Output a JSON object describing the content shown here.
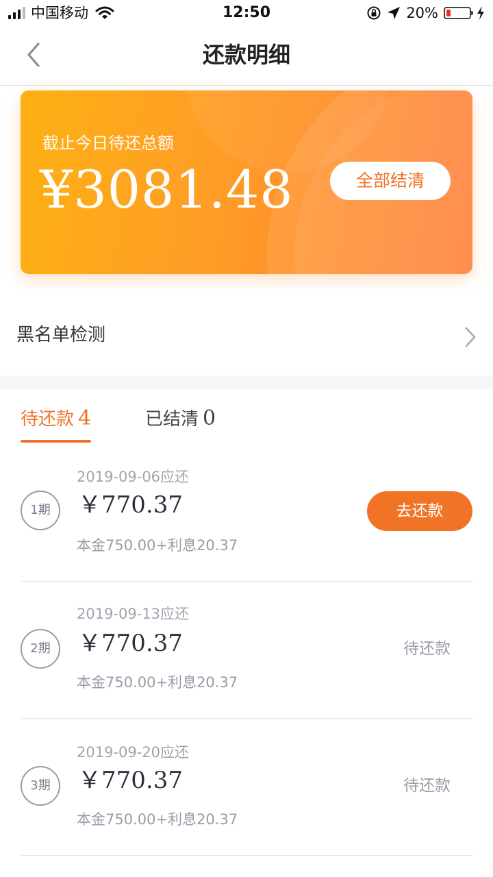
{
  "status_bar": {
    "carrier": "中国移动",
    "time": "12:50",
    "battery": "20%",
    "battery_level": 0.2,
    "icons": [
      "signal-icon",
      "wifi-icon",
      "orientation-lock-icon",
      "location-arrow-icon",
      "battery-icon",
      "charging-bolt-icon"
    ]
  },
  "nav": {
    "title": "还款明细",
    "back_icon": "chevron-left-icon"
  },
  "summary": {
    "label": "截止今日待还总额",
    "amount": "¥3081.48",
    "settle_button": "全部结清"
  },
  "blacklist": {
    "label": "黑名单检测",
    "icon": "chevron-right-icon"
  },
  "tabs": [
    {
      "label": "待还款",
      "count": "4",
      "active": true
    },
    {
      "label": "已结清",
      "count": "0",
      "active": false
    }
  ],
  "installments": [
    {
      "period": "1期",
      "due": "2019-09-06应还",
      "amount": "￥770.37",
      "breakdown": "本金750.00+利息20.37",
      "action": "去还款"
    },
    {
      "period": "2期",
      "due": "2019-09-13应还",
      "amount": "￥770.37",
      "breakdown": "本金750.00+利息20.37",
      "status": "待还款"
    },
    {
      "period": "3期",
      "due": "2019-09-20应还",
      "amount": "￥770.37",
      "breakdown": "本金750.00+利息20.37",
      "status": "待还款"
    }
  ],
  "colors": {
    "accent": "#f07326",
    "card_start": "#fdb012",
    "card_end": "#ff7a30",
    "battery_low": "#e8312e"
  }
}
